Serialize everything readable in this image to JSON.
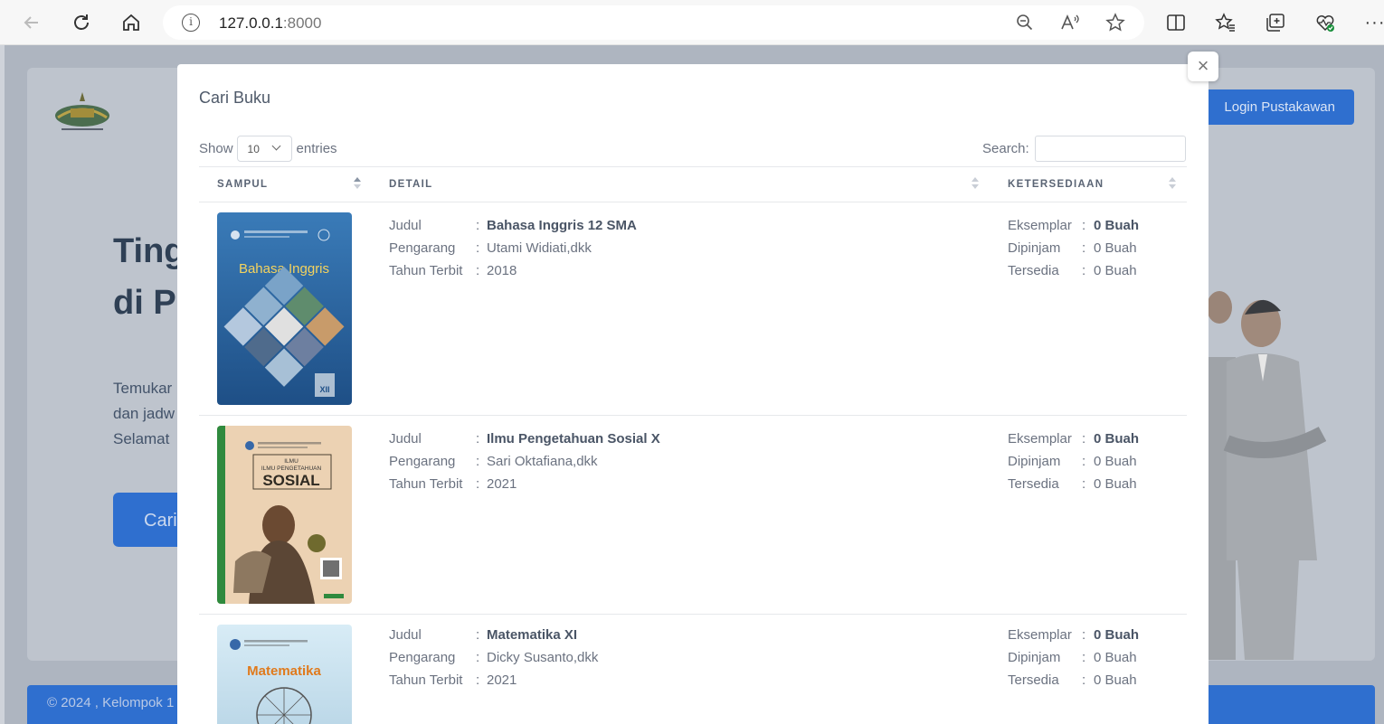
{
  "browser": {
    "url_host": "127.0.0.1",
    "url_port": ":8000"
  },
  "background": {
    "hero_title_lines": [
      "Ting",
      "di P"
    ],
    "hero_text_lines": [
      "Temukar",
      "dan jadw",
      "Selamat"
    ],
    "hero_button": "Cari",
    "login_button": "Login Pustakawan",
    "footer": "© 2024 , Kelompok 1"
  },
  "modal": {
    "title": "Cari Buku",
    "close_label": "×",
    "show_label": "Show",
    "entries_value": "10",
    "entries_label": "entries",
    "search_label": "Search:",
    "columns": [
      "SAMPUL",
      "DETAIL",
      "KETERSEDIAAN"
    ],
    "labels": {
      "judul": "Judul",
      "pengarang": "Pengarang",
      "tahun": "Tahun Terbit",
      "eksemplar": "Eksemplar",
      "dipinjam": "Dipinjam",
      "tersedia": "Tersedia",
      "colon": ":"
    },
    "books": [
      {
        "cover_title": "Bahasa Inggris",
        "cover_badge": "XII",
        "cover_color": "#2a5d95",
        "judul": "Bahasa Inggris 12 SMA",
        "pengarang": "Utami Widiati,dkk",
        "tahun": "2018",
        "eksemplar": "0 Buah",
        "dipinjam": "0 Buah",
        "tersedia": "0 Buah"
      },
      {
        "cover_title_top": "ILMU PENGETAHUAN",
        "cover_title": "SOSIAL",
        "cover_color": "#e9c9a8",
        "judul": "Ilmu Pengetahuan Sosial X",
        "pengarang": "Sari Oktafiana,dkk",
        "tahun": "2021",
        "eksemplar": "0 Buah",
        "dipinjam": "0 Buah",
        "tersedia": "0 Buah"
      },
      {
        "cover_title": "Matematika",
        "cover_color": "#cfe4f0",
        "judul": "Matematika XI",
        "pengarang": "Dicky Susanto,dkk",
        "tahun": "2021",
        "eksemplar": "0 Buah",
        "dipinjam": "0 Buah",
        "tersedia": "0 Buah"
      }
    ]
  }
}
